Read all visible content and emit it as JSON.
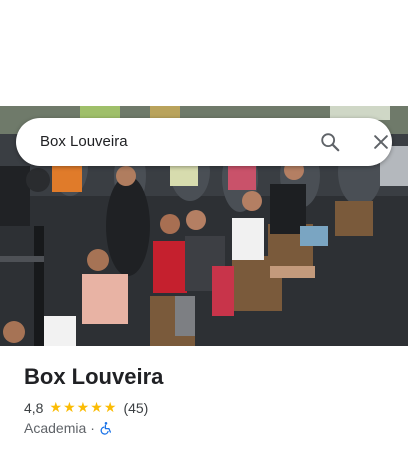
{
  "search": {
    "query": "Box Louveira",
    "search_icon": "search-icon",
    "clear_icon": "close-icon"
  },
  "hero": {
    "description_icon": "gym-group-photo"
  },
  "place": {
    "name": "Box Louveira",
    "rating": "4,8",
    "stars": 5,
    "reviews": "(45)",
    "category": "Academia",
    "separator": "·",
    "accessibility_icon": "wheelchair-icon"
  },
  "colors": {
    "star": "#fbbc04",
    "accessibility": "#1a73e8",
    "text_primary": "#202124",
    "text_secondary": "#5f6368"
  }
}
